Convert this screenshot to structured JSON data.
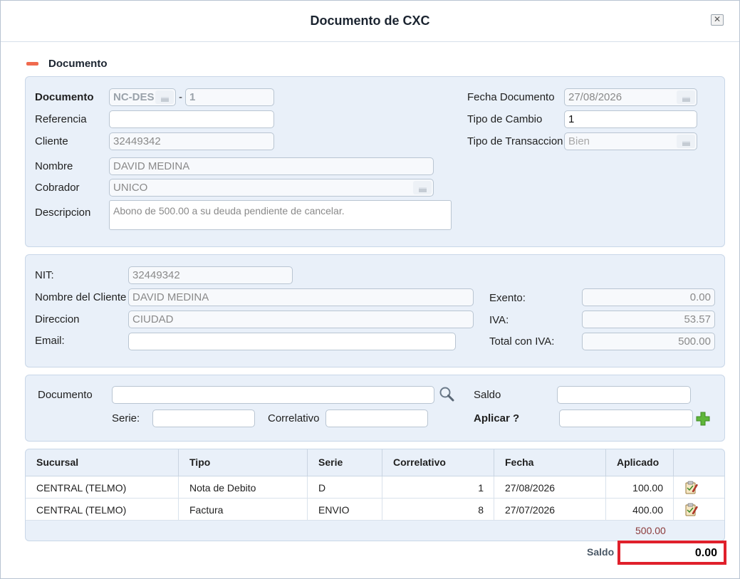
{
  "dialog": {
    "title": "Documento de CXC",
    "close_label": "✕"
  },
  "section": {
    "title": "Documento"
  },
  "header_panel": {
    "documento_label": "Documento",
    "documento_tipo": "NC-DES",
    "separator": "-",
    "documento_numero": "1",
    "referencia_label": "Referencia",
    "referencia_value": "",
    "cliente_label": "Cliente",
    "cliente_value": "32449342",
    "nombre_label": "Nombre",
    "nombre_value": "DAVID MEDINA",
    "cobrador_label": "Cobrador",
    "cobrador_value": "UNICO",
    "descripcion_label": "Descripcion",
    "descripcion_value": "Abono de 500.00 a su deuda pendiente de cancelar.",
    "fecha_label": "Fecha Documento",
    "fecha_value": "27/08/2026",
    "tipo_cambio_label": "Tipo de Cambio",
    "tipo_cambio_value": "1",
    "tipo_transaccion_label": "Tipo de Transaccion",
    "tipo_transaccion_value": "Bien"
  },
  "client_panel": {
    "nit_label": "NIT:",
    "nit_value": "32449342",
    "nombre_cliente_label": "Nombre del Cliente",
    "nombre_cliente_value": "DAVID MEDINA",
    "direccion_label": "Direccion",
    "direccion_value": "CIUDAD",
    "email_label": "Email:",
    "email_value": "",
    "exento_label": "Exento:",
    "exento_value": "0.00",
    "iva_label": "IVA:",
    "iva_value": "53.57",
    "total_iva_label": "Total con IVA:",
    "total_iva_value": "500.00"
  },
  "apply_panel": {
    "documento_label": "Documento",
    "documento_value": "",
    "saldo_label": "Saldo",
    "saldo_value": "",
    "serie_label": "Serie:",
    "serie_value": "",
    "correlativo_label": "Correlativo",
    "correlativo_value": "",
    "aplicar_label": "Aplicar ?",
    "aplicar_value": ""
  },
  "table": {
    "columns": [
      "Sucursal",
      "Tipo",
      "Serie",
      "Correlativo",
      "Fecha",
      "Aplicado"
    ],
    "rows": [
      {
        "sucursal": "CENTRAL (TELMO)",
        "tipo": "Nota de Debito",
        "serie": "D",
        "correlativo": "1",
        "fecha": "27/08/2026",
        "aplicado": "100.00"
      },
      {
        "sucursal": "CENTRAL (TELMO)",
        "tipo": "Factura",
        "serie": "ENVIO",
        "correlativo": "8",
        "fecha": "27/07/2026",
        "aplicado": "400.00"
      }
    ],
    "total_aplicado": "500.00"
  },
  "footer": {
    "saldo_label": "Saldo",
    "saldo_value": "0.00"
  },
  "colors": {
    "panel_bg": "#e9f0f9",
    "highlight_border": "#e0202b",
    "total_text": "#8b3a3a",
    "collapse_icon": "#f06a4e"
  }
}
